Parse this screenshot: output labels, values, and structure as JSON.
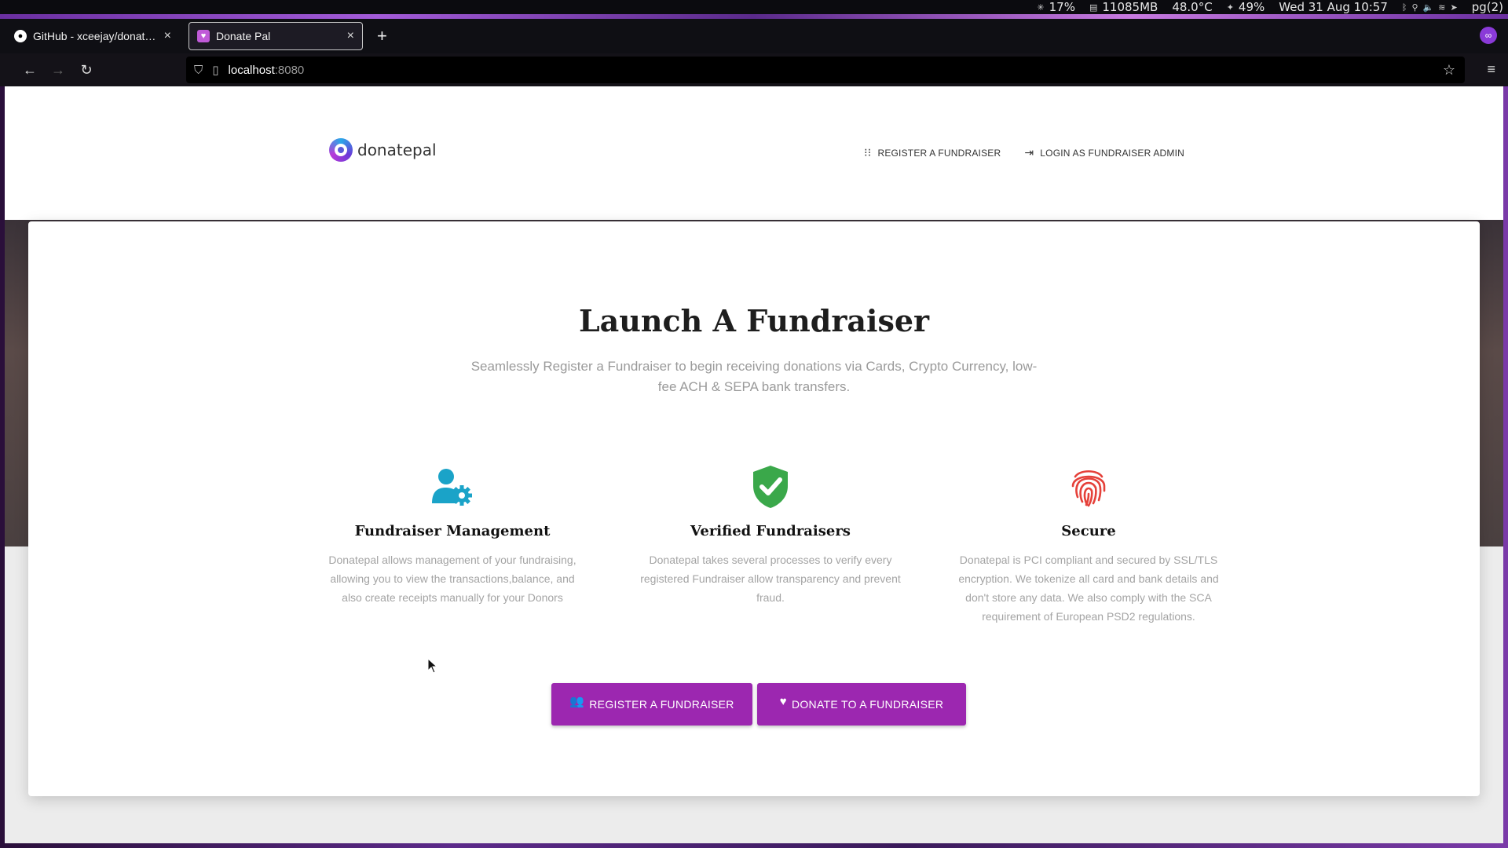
{
  "system_bar": {
    "cpu": "17%",
    "memory": "11085MB",
    "temperature": "48.0°C",
    "volume": "49%",
    "datetime": "Wed 31 Aug 10:57",
    "workspace": "pg(2)"
  },
  "browser": {
    "tabs": [
      {
        "title": "GitHub - xceejay/donate-pal",
        "favicon": "github-icon",
        "active": false
      },
      {
        "title": "Donate Pal",
        "favicon": "donatepal-favicon",
        "active": true
      }
    ],
    "url_host": "localhost",
    "url_port": ":8080"
  },
  "site": {
    "brand": "donatepal",
    "nav": {
      "register": "REGISTER A FUNDRAISER",
      "login": "LOGIN AS FUNDRAISER ADMIN"
    }
  },
  "hero": {
    "title": "Launch A Fundraiser",
    "lead": "Seamlessly Register a Fundraiser to begin receiving donations via Cards, Crypto Currency, low-fee ACH & SEPA bank transfers."
  },
  "features": [
    {
      "icon": "user-gear-icon",
      "color": "#1aa3c8",
      "title": "Fundraiser Management",
      "text": "Donatepal allows management of your fundraising, allowing you to view the transactions,balance, and also create receipts manually for your Donors"
    },
    {
      "icon": "shield-check-icon",
      "color": "#3aa84a",
      "title": "Verified Fundraisers",
      "text": "Donatepal takes several processes to verify every registered Fundraiser allow transparency and prevent fraud."
    },
    {
      "icon": "fingerprint-icon",
      "color": "#e5413a",
      "title": "Secure",
      "text": "Donatepal is PCI compliant and secured by SSL/TLS encryption. We tokenize all card and bank details and don't store any data. We also comply with the SCA requirement of European PSD2 regulations."
    }
  ],
  "actions": {
    "register": "REGISTER A FUNDRAISER",
    "donate": "DONATE TO A FUNDRAISER"
  },
  "colors": {
    "accent": "#9c27b0"
  }
}
